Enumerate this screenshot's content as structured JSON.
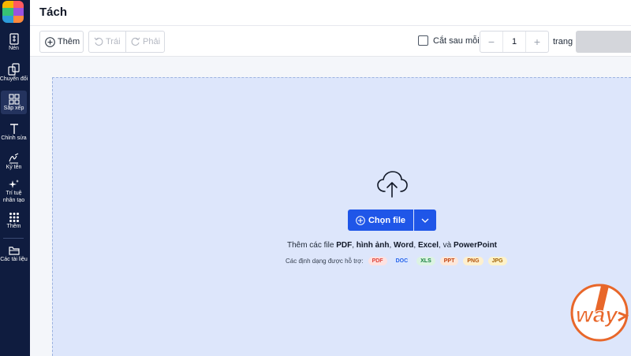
{
  "header": {
    "title": "Tách"
  },
  "sidebar": {
    "items": [
      {
        "label": "Nén",
        "icon": "compress-icon"
      },
      {
        "label": "Chuyển đổi",
        "icon": "convert-icon"
      },
      {
        "label": "Sắp xếp",
        "icon": "organize-grid-icon",
        "active": true
      },
      {
        "label": "Chỉnh sửa",
        "icon": "text-edit-icon"
      },
      {
        "label": "Ký tên",
        "icon": "signature-icon"
      },
      {
        "label": "Trí tuệ",
        "label2": "nhân tạo",
        "icon": "ai-sparkle-icon"
      },
      {
        "label": "Thêm",
        "icon": "more-grid-icon"
      },
      {
        "label": "Các tài liệu",
        "icon": "folder-icon"
      }
    ]
  },
  "toolbar": {
    "add_label": "Thêm",
    "rotate_left_label": "Trái",
    "rotate_right_label": "Phải",
    "split_after_label": "Cắt sau mỗi",
    "split_after_value": "1",
    "pages_label": "trang",
    "minus": "−",
    "plus": "+"
  },
  "dropzone": {
    "choose_label": "Chọn file",
    "add_text_prefix": "Thêm các file ",
    "pdf": "PDF",
    "sep1": ", ",
    "images": "hình ảnh",
    "sep2": ", ",
    "word": "Word",
    "sep3": ", ",
    "excel": "Excel",
    "sep4": ", và ",
    "powerpoint": "PowerPoint",
    "formats_label": "Các định dạng được hỗ trợ:",
    "formats": [
      {
        "label": "PDF",
        "color": "#e0443a",
        "bg": "#fde2e1"
      },
      {
        "label": "DOC",
        "color": "#2563eb",
        "bg": "#dbe6fd"
      },
      {
        "label": "XLS",
        "color": "#15803d",
        "bg": "#dcf3e3"
      },
      {
        "label": "PPT",
        "color": "#c2410c",
        "bg": "#fde7d9"
      },
      {
        "label": "PNG",
        "color": "#b45309",
        "bg": "#fdf0cf"
      },
      {
        "label": "JPG",
        "color": "#a16207",
        "bg": "#fdf2c8"
      }
    ]
  },
  "watermark": {
    "text": "way",
    "digit": "1"
  },
  "colors": {
    "primary": "#1f56e8",
    "sidebar": "#0f1c3f",
    "dropzone": "#dde6fb"
  }
}
